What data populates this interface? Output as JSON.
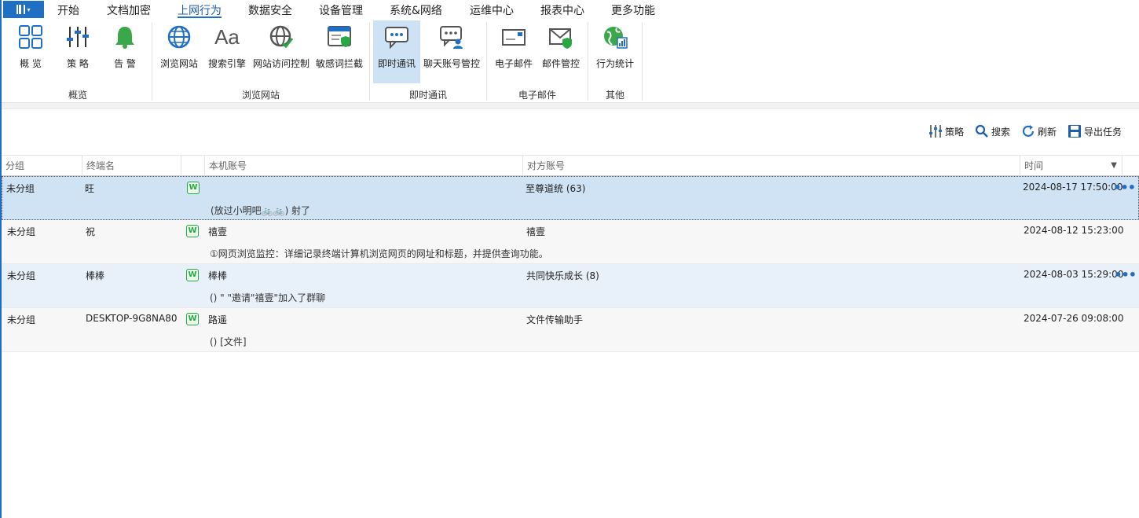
{
  "menu": {
    "items": [
      "开始",
      "文档加密",
      "上网行为",
      "数据安全",
      "设备管理",
      "系统&网络",
      "运维中心",
      "报表中心",
      "更多功能"
    ],
    "active": "上网行为"
  },
  "ribbon": {
    "tools": [
      {
        "label": "概 览",
        "icon": "overview-grid-icon"
      },
      {
        "label": "策 略",
        "icon": "strategy-sliders-icon"
      },
      {
        "label": "告 警",
        "icon": "alarm-bell-icon"
      },
      {
        "label": "浏览网站",
        "icon": "globe-icon"
      },
      {
        "label": "搜索引擎",
        "icon": "search-engine-aa-icon"
      },
      {
        "label": "网站访问控制",
        "icon": "globe-check-icon"
      },
      {
        "label": "敏感词拦截",
        "icon": "browser-shield-icon"
      },
      {
        "label": "即时通讯",
        "icon": "chat-bubble-icon"
      },
      {
        "label": "聊天账号管控",
        "icon": "chat-user-icon"
      },
      {
        "label": "电子邮件",
        "icon": "mail-icon"
      },
      {
        "label": "邮件管控",
        "icon": "mail-shield-icon"
      },
      {
        "label": "行为统计",
        "icon": "globe-stats-icon"
      }
    ],
    "groups": [
      "概览",
      "浏览网站",
      "即时通讯",
      "电子邮件",
      "其他"
    ]
  },
  "toolbar": {
    "strategy": "策略",
    "search": "搜索",
    "refresh": "刷新",
    "export": "导出任务"
  },
  "table": {
    "headers": [
      "分组",
      "终端名",
      "本机账号",
      "对方账号",
      "时间"
    ],
    "rows": [
      {
        "group": "未分组",
        "terminal": "旺",
        "local": "",
        "peer": "至尊道统 (63)",
        "time": "2024-08-17 17:50:00",
        "message": "(放过小明吧🚲🚲) 射了"
      },
      {
        "group": "未分组",
        "terminal": "祝",
        "local": "禧壹",
        "peer": "禧壹",
        "time": "2024-08-12 15:23:00",
        "message": "①网页浏览监控：详细记录终端计算机浏览网页的网址和标题，并提供查询功能。"
      },
      {
        "group": "未分组",
        "terminal": "棒棒",
        "local": "棒棒",
        "peer": "共同快乐成长 (8)",
        "time": "2024-08-03 15:29:00",
        "message": "() \"        \"邀请\"禧壹\"加入了群聊"
      },
      {
        "group": "未分组",
        "terminal": "DESKTOP-9G8NA80",
        "local": "路遥",
        "peer": "文件传输助手",
        "time": "2024-07-26 09:08:00",
        "message": "() [文件]"
      }
    ]
  },
  "colors": {
    "accent": "#1f6fc5",
    "selected_row": "#cfe3f4",
    "alt_row": "#e8f1f9",
    "wechat": "#2aa745"
  }
}
